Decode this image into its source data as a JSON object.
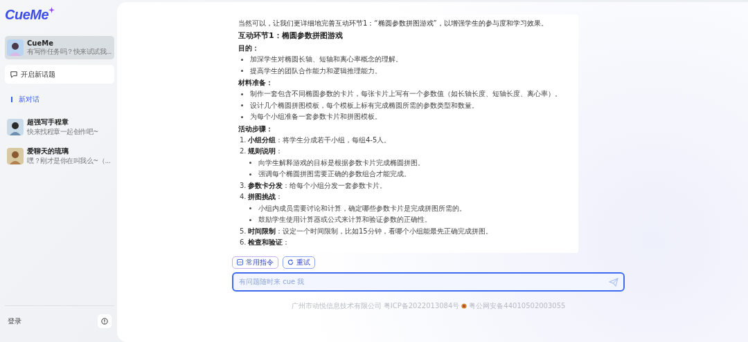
{
  "logo": {
    "text": "CueMe"
  },
  "sidebar": {
    "chats": [
      {
        "name": "CueMe",
        "preview": "有写作任务吗？快来试试我...",
        "selected": true
      },
      {
        "name": "超强写手程章",
        "preview": "快来找程章一起创作吧~",
        "selected": false
      },
      {
        "name": "爱聊天的琉璃",
        "preview": "嘿？刚才是你在叫我么~（...",
        "selected": false
      }
    ],
    "new_topic_button": "开启新话题",
    "section_label": "新对话",
    "login": "登录"
  },
  "chat": {
    "blocks": [
      {
        "kind": "paragraph",
        "text": "当然可以，让我们更详细地完善互动环节1：“椭圆参数拼图游戏”，以增强学生的参与度和学习效果。"
      },
      {
        "kind": "heading",
        "text": "互动环节1：椭圆参数拼图游戏"
      },
      {
        "kind": "label",
        "text": "目的："
      },
      {
        "kind": "bullet",
        "text": "加深学生对椭圆长轴、短轴和离心率概念的理解。"
      },
      {
        "kind": "bullet",
        "text": "提高学生的团队合作能力和逻辑推理能力。"
      },
      {
        "kind": "label",
        "text": "材料准备："
      },
      {
        "kind": "bullet",
        "text": "制作一套包含不同椭圆参数的卡片，每张卡片上写有一个参数值（如长轴长度、短轴长度、离心率）。"
      },
      {
        "kind": "bullet",
        "text": "设计几个椭圆拼图模板，每个模板上标有完成椭圆所需的参数类型和数量。"
      },
      {
        "kind": "bullet",
        "text": "为每个小组准备一套参数卡片和拼图模板。"
      },
      {
        "kind": "label",
        "text": "活动步骤："
      },
      {
        "kind": "step",
        "number": "1.",
        "text": "**小组分组**：将学生分成若干小组，每组4-5人。"
      },
      {
        "kind": "step",
        "number": "2.",
        "text": "**规则说明**："
      },
      {
        "kind": "sub_bullet",
        "text": "向学生解释游戏的目标是根据参数卡片完成椭圆拼图。"
      },
      {
        "kind": "sub_bullet",
        "text": "强调每个椭圆拼图需要正确的参数组合才能完成。"
      },
      {
        "kind": "step",
        "number": "3.",
        "text": "**参数卡分发**：给每个小组分发一套参数卡片。"
      },
      {
        "kind": "step",
        "number": "4.",
        "text": "**拼图挑战**："
      },
      {
        "kind": "sub_bullet",
        "text": "小组内成员需要讨论和计算，确定哪些参数卡片是完成拼图所需的。"
      },
      {
        "kind": "sub_bullet",
        "text": "鼓励学生使用计算器或公式来计算和验证参数的正确性。"
      },
      {
        "kind": "step",
        "number": "5.",
        "text": "**时间限制**：设定一个时间限制，比如15分钟，看哪个小组能最先正确完成拼图。"
      },
      {
        "kind": "step",
        "number": "6.",
        "text": "**检查和验证**："
      }
    ],
    "actions": [
      {
        "kind": "commands",
        "label": "常用指令"
      },
      {
        "kind": "retry",
        "label": "重试"
      }
    ],
    "input": {
      "placeholder": "有问题随时来 cue 我"
    }
  },
  "footer": {
    "company": "广州市动悦信息技术有限公司 粤ICP备2022013084号",
    "police": "粤公网安备44010502003055"
  }
}
